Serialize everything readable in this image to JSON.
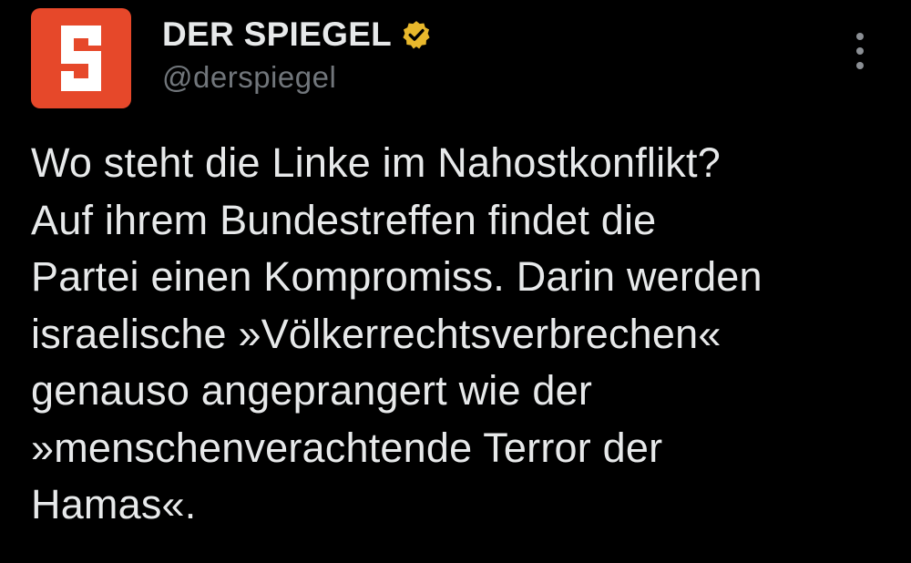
{
  "author": {
    "display_name": "DER SPIEGEL",
    "handle": "@derspiegel",
    "avatar_letter": "S",
    "avatar_color": "#e6482a",
    "verified_badge_icon": "verified-badge-icon",
    "verified_badge_color": "#e8b82c"
  },
  "menu": {
    "icon": "more-options-icon"
  },
  "tweet": {
    "lines": [
      "Wo steht die Linke im Nahostkonflikt?",
      "Auf ihrem Bundestreffen findet die",
      "Partei einen Kompromiss. Darin werden",
      "israelische »Völkerrechtsverbrechen«",
      "genauso angeprangert wie der",
      "»menschenverachtende Terror der",
      "Hamas«."
    ]
  }
}
